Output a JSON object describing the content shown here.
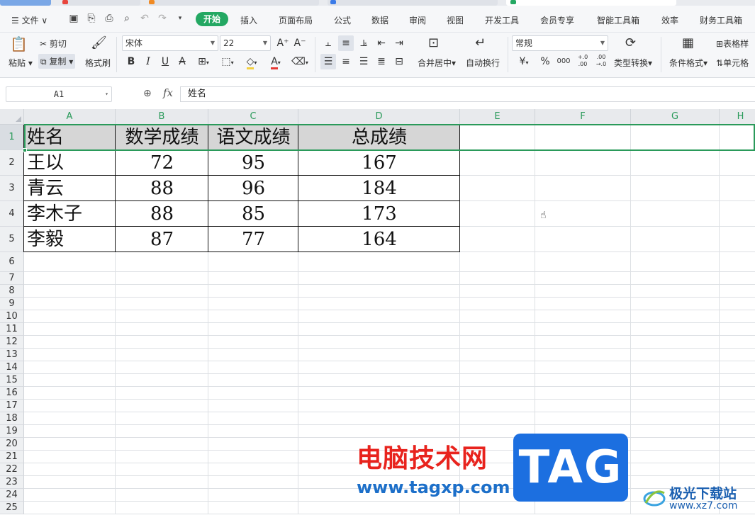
{
  "menu": {
    "file": "文件",
    "tabs": [
      "开始",
      "插入",
      "页面布局",
      "公式",
      "数据",
      "审阅",
      "视图",
      "开发工具",
      "会员专享",
      "智能工具箱",
      "效率",
      "财务工具箱"
    ],
    "active_tab": "开始"
  },
  "ribbon": {
    "paste": "粘贴",
    "cut": "剪切",
    "copy": "复制",
    "format_painter": "格式刷",
    "font_name": "宋体",
    "font_size": "22",
    "merge_center": "合并居中",
    "wrap_text": "自动换行",
    "number_format": "常规",
    "type_convert": "类型转换",
    "conditional_format": "条件格式",
    "table_style": "表格样",
    "cell": "单元格",
    "currency": "¥",
    "percent": "%",
    "thousands": "000",
    "inc_decimal": "+.0 .00",
    "dec_decimal": ".00 →.0",
    "bold": "B",
    "italic": "I",
    "underline": "U",
    "strike": "A",
    "font_color": "A",
    "fill_color": "◇",
    "increase_font": "A⁺",
    "decrease_font": "A⁻"
  },
  "formula_bar": {
    "name_box": "A1",
    "fx": "fx",
    "content": "姓名"
  },
  "sheet": {
    "columns": [
      "A",
      "B",
      "C",
      "D",
      "E",
      "F",
      "G",
      "H"
    ],
    "rows": [
      "1",
      "2",
      "3",
      "4",
      "5",
      "6",
      "7",
      "8",
      "9",
      "10",
      "11",
      "12",
      "13",
      "14",
      "15",
      "16",
      "17",
      "18",
      "19",
      "20",
      "21",
      "22",
      "23",
      "24",
      "25"
    ],
    "table": {
      "header": [
        "姓名",
        "数学成绩",
        "语文成绩",
        "总成绩"
      ],
      "rows": [
        [
          "王以",
          "72",
          "95",
          "167"
        ],
        [
          "青云",
          "88",
          "96",
          "184"
        ],
        [
          "李木子",
          "88",
          "85",
          "173"
        ],
        [
          "李毅",
          "87",
          "77",
          "164"
        ]
      ]
    }
  },
  "watermark": {
    "site_name": "电脑技术网",
    "site_url": "www.tagxp.com",
    "tag": "TAG",
    "site2_name": "极光下载站",
    "site2_url": "www.xz7.com"
  },
  "colors": {
    "accent": "#24a863",
    "selection": "#2a9a5a",
    "header_fill": "#d6d6d6"
  }
}
